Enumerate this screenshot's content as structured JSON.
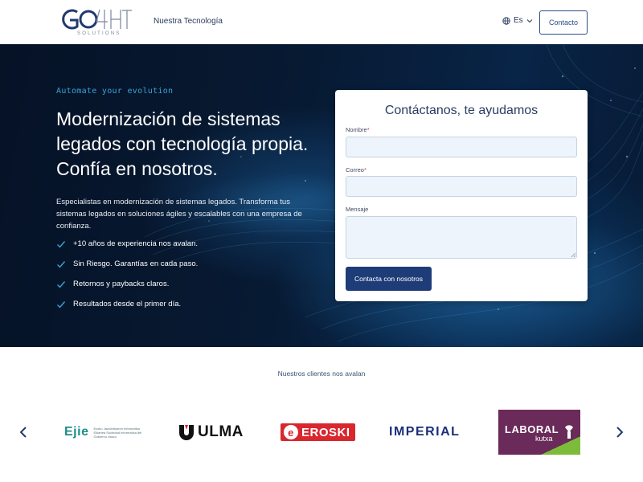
{
  "header": {
    "logo_sub": "SOLUTIONS",
    "nav_link": "Nuestra Tecnología",
    "language": "Es",
    "contact_label": "Contacto"
  },
  "hero": {
    "tagline": "Automate your evolution",
    "headline": "Modernización de sistemas legados con tecnología propia. Confía en nosotros.",
    "description": "Especialistas en modernización de sistemas legados. Transforma tus sistemas legados en soluciones ágiles y escalables con una empresa de confianza.",
    "benefits": [
      "+10 años de experiencia nos avalan.",
      "Sin Riesgo. Garantías en cada paso.",
      "Retornos y paybacks claros.",
      "Resultados desde el primer día."
    ]
  },
  "form": {
    "title": "Contáctanos, te ayudamos",
    "name_label": "Nombre",
    "email_label": "Correo",
    "required_mark": "*",
    "message_label": "Mensaje",
    "name_value": "",
    "email_value": "",
    "message_value": "",
    "submit_label": "Contacta con nosotros"
  },
  "clients": {
    "title": "Nuestros clientes nos avalan",
    "logos": [
      {
        "name": "Ejie",
        "subtext": "Eusko Jaurlaritzaren Informatika Elkartea Sociedad Informática del Gobierno Vasco"
      },
      {
        "name": "ULMA"
      },
      {
        "name": "EROSKI"
      },
      {
        "name": "IMPERIAL"
      },
      {
        "name": "LABORAL",
        "subtext": "kutxa"
      }
    ]
  },
  "colors": {
    "brand_navy": "#1e3d78",
    "hero_bg": "#071a33",
    "accent_cyan": "#3aa3d8",
    "eroski_red": "#d9272e",
    "laboral_purple": "#6a2a5a",
    "laboral_green": "#7dbc3b"
  },
  "icons": [
    "globe-icon",
    "chevron-down-icon",
    "check-icon",
    "chevron-left-icon",
    "chevron-right-icon"
  ]
}
